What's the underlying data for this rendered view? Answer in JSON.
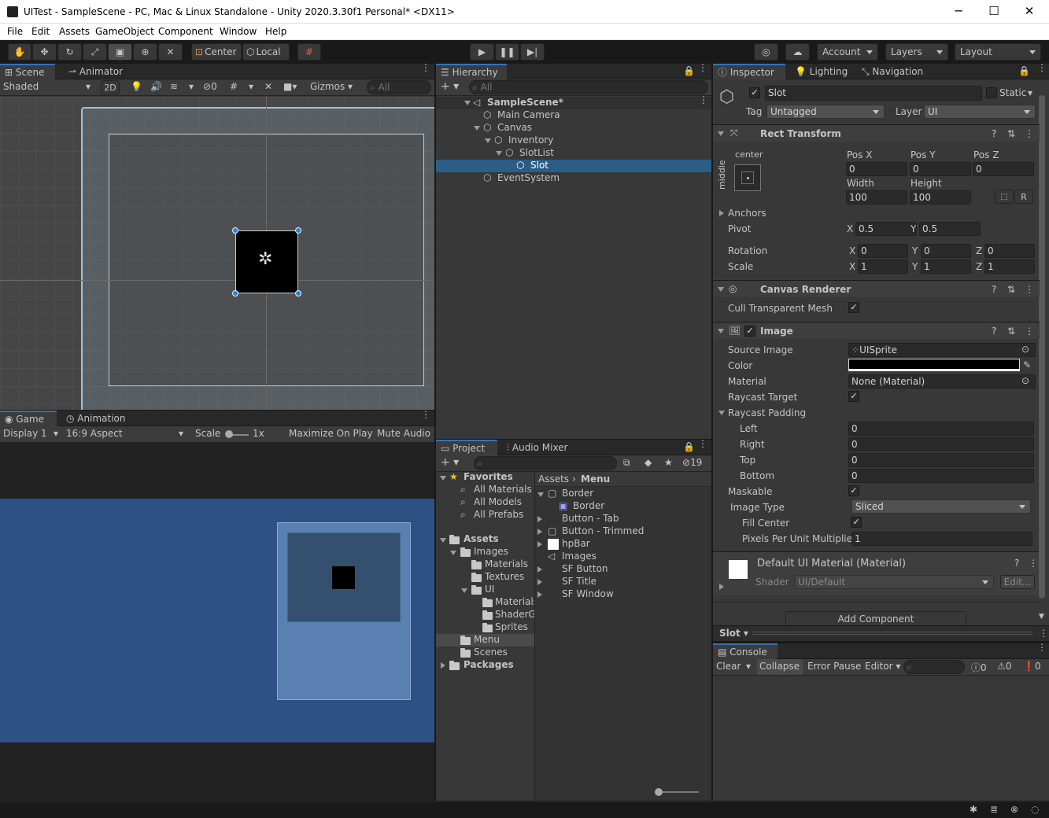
{
  "window": {
    "title": "UITest - SampleScene - PC, Mac & Linux Standalone - Unity 2020.3.30f1 Personal* <DX11>",
    "minimize": "─",
    "maximize": "☐",
    "close": "✕"
  },
  "menu": [
    "File",
    "Edit",
    "Assets",
    "GameObject",
    "Component",
    "Window",
    "Help"
  ],
  "toolbar": {
    "pivot_mode": "Center",
    "pivot_rotation": "Local",
    "account": "Account",
    "layers": "Layers",
    "layout": "Layout"
  },
  "scene": {
    "tabs": [
      "Scene",
      "Animator"
    ],
    "shading": "Shaded",
    "mode_2d": "2D",
    "hidden_count": "0",
    "gizmos": "Gizmos",
    "search_placeholder": "All"
  },
  "game": {
    "tabs": [
      "Game",
      "Animation"
    ],
    "display": "Display 1",
    "aspect": "16:9 Aspect",
    "scale_label": "Scale",
    "scale_value": "1x",
    "maximize": "Maximize On Play",
    "mute": "Mute Audio",
    "background": "#2e5185"
  },
  "hierarchy": {
    "tab": "Hierarchy",
    "search_placeholder": "All",
    "items": [
      "SampleScene*",
      "Main Camera",
      "Canvas",
      "Inventory",
      "SlotList",
      "Slot",
      "EventSystem"
    ]
  },
  "project": {
    "tabs": [
      "Project",
      "Audio Mixer"
    ],
    "hidden_count": "19",
    "favorites": {
      "label": "Favorites",
      "items": [
        "All Materials",
        "All Models",
        "All Prefabs"
      ]
    },
    "tree": [
      "Assets",
      "Images",
      "Materials",
      "Textures",
      "UI",
      "Materials",
      "ShaderGraphs",
      "Sprites",
      "Menu",
      "Scenes",
      "Packages"
    ],
    "breadcrumb": [
      "Assets",
      "Menu"
    ],
    "assets": [
      "Border",
      "Border",
      "Button - Tab",
      "Button - Trimmed",
      "hpBar",
      "Images",
      "SF Button",
      "SF Title",
      "SF Window"
    ]
  },
  "inspector": {
    "tabs": [
      "Inspector",
      "Lighting",
      "Navigation"
    ],
    "name": "Slot",
    "static_label": "Static",
    "tag_label": "Tag",
    "tag": "Untagged",
    "layer_label": "Layer",
    "layer": "UI",
    "rect_transform": {
      "title": "Rect Transform",
      "anchor_h": "center",
      "anchor_v": "middle",
      "pos_x_label": "Pos X",
      "pos_y_label": "Pos Y",
      "pos_z_label": "Pos Z",
      "pos_x": "0",
      "pos_y": "0",
      "pos_z": "0",
      "width_label": "Width",
      "height_label": "Height",
      "width": "100",
      "height": "100",
      "r_button": "R",
      "anchors": "Anchors",
      "pivot": "Pivot",
      "pivot_x": "0.5",
      "pivot_y": "0.5",
      "rotation": "Rotation",
      "rot_x": "0",
      "rot_y": "0",
      "rot_z": "0",
      "scale": "Scale",
      "scale_x": "1",
      "scale_y": "1",
      "scale_z": "1",
      "x": "X",
      "y": "Y",
      "z": "Z"
    },
    "canvas_renderer": {
      "title": "Canvas Renderer",
      "cull": "Cull Transparent Mesh"
    },
    "image": {
      "title": "Image",
      "source_image_label": "Source Image",
      "source_image": "UISprite",
      "color_label": "Color",
      "color": "#000000",
      "material_label": "Material",
      "material": "None (Material)",
      "raycast_target": "Raycast Target",
      "raycast_padding": "Raycast Padding",
      "left_label": "Left",
      "left": "0",
      "right_label": "Right",
      "right": "0",
      "top_label": "Top",
      "top": "0",
      "bottom_label": "Bottom",
      "bottom": "0",
      "maskable": "Maskable",
      "image_type_label": "Image Type",
      "image_type": "Sliced",
      "fill_center": "Fill Center",
      "ppu_label": "Pixels Per Unit Multiplier",
      "ppu": "1"
    },
    "material": {
      "title": "Default UI Material (Material)",
      "shader_label": "Shader",
      "shader": "UI/Default",
      "edit": "Edit..."
    },
    "add_component": "Add Component",
    "preview": "Slot"
  },
  "console": {
    "tab": "Console",
    "clear": "Clear",
    "collapse": "Collapse",
    "error_pause": "Error Pause",
    "editor": "Editor",
    "logs": "0",
    "warnings": "0",
    "errors": "0"
  }
}
